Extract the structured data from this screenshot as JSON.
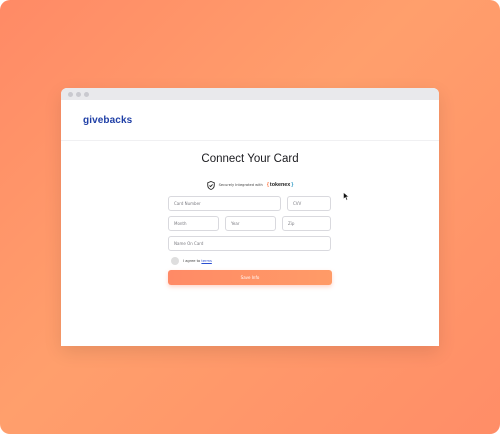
{
  "brand": {
    "name": "givebacks",
    "color": "#1f3fa6"
  },
  "page": {
    "title": "Connect Your Card"
  },
  "security": {
    "label": "Securely Integrated with",
    "provider_name": "tokenex",
    "left_brace": "{",
    "right_brace": "}"
  },
  "form": {
    "card_number": {
      "placeholder": "Card Number"
    },
    "cvv": {
      "placeholder": "CVV"
    },
    "month": {
      "placeholder": "Month"
    },
    "year": {
      "placeholder": "Year"
    },
    "zip": {
      "placeholder": "Zip"
    },
    "name_on_card": {
      "placeholder": "Name On Card"
    },
    "agreement": {
      "prefix": "I agree to",
      "link_text": "terms"
    },
    "save_button": {
      "label": "Save Info"
    }
  },
  "colors": {
    "accent": "#ff8a66",
    "background_gradient_start": "#ff8a66",
    "background_gradient_end": "#ff9f6c",
    "link": "#2b4fd1"
  },
  "icons": {
    "security": "shield-check-icon",
    "pointer": "mouse-cursor-icon"
  }
}
